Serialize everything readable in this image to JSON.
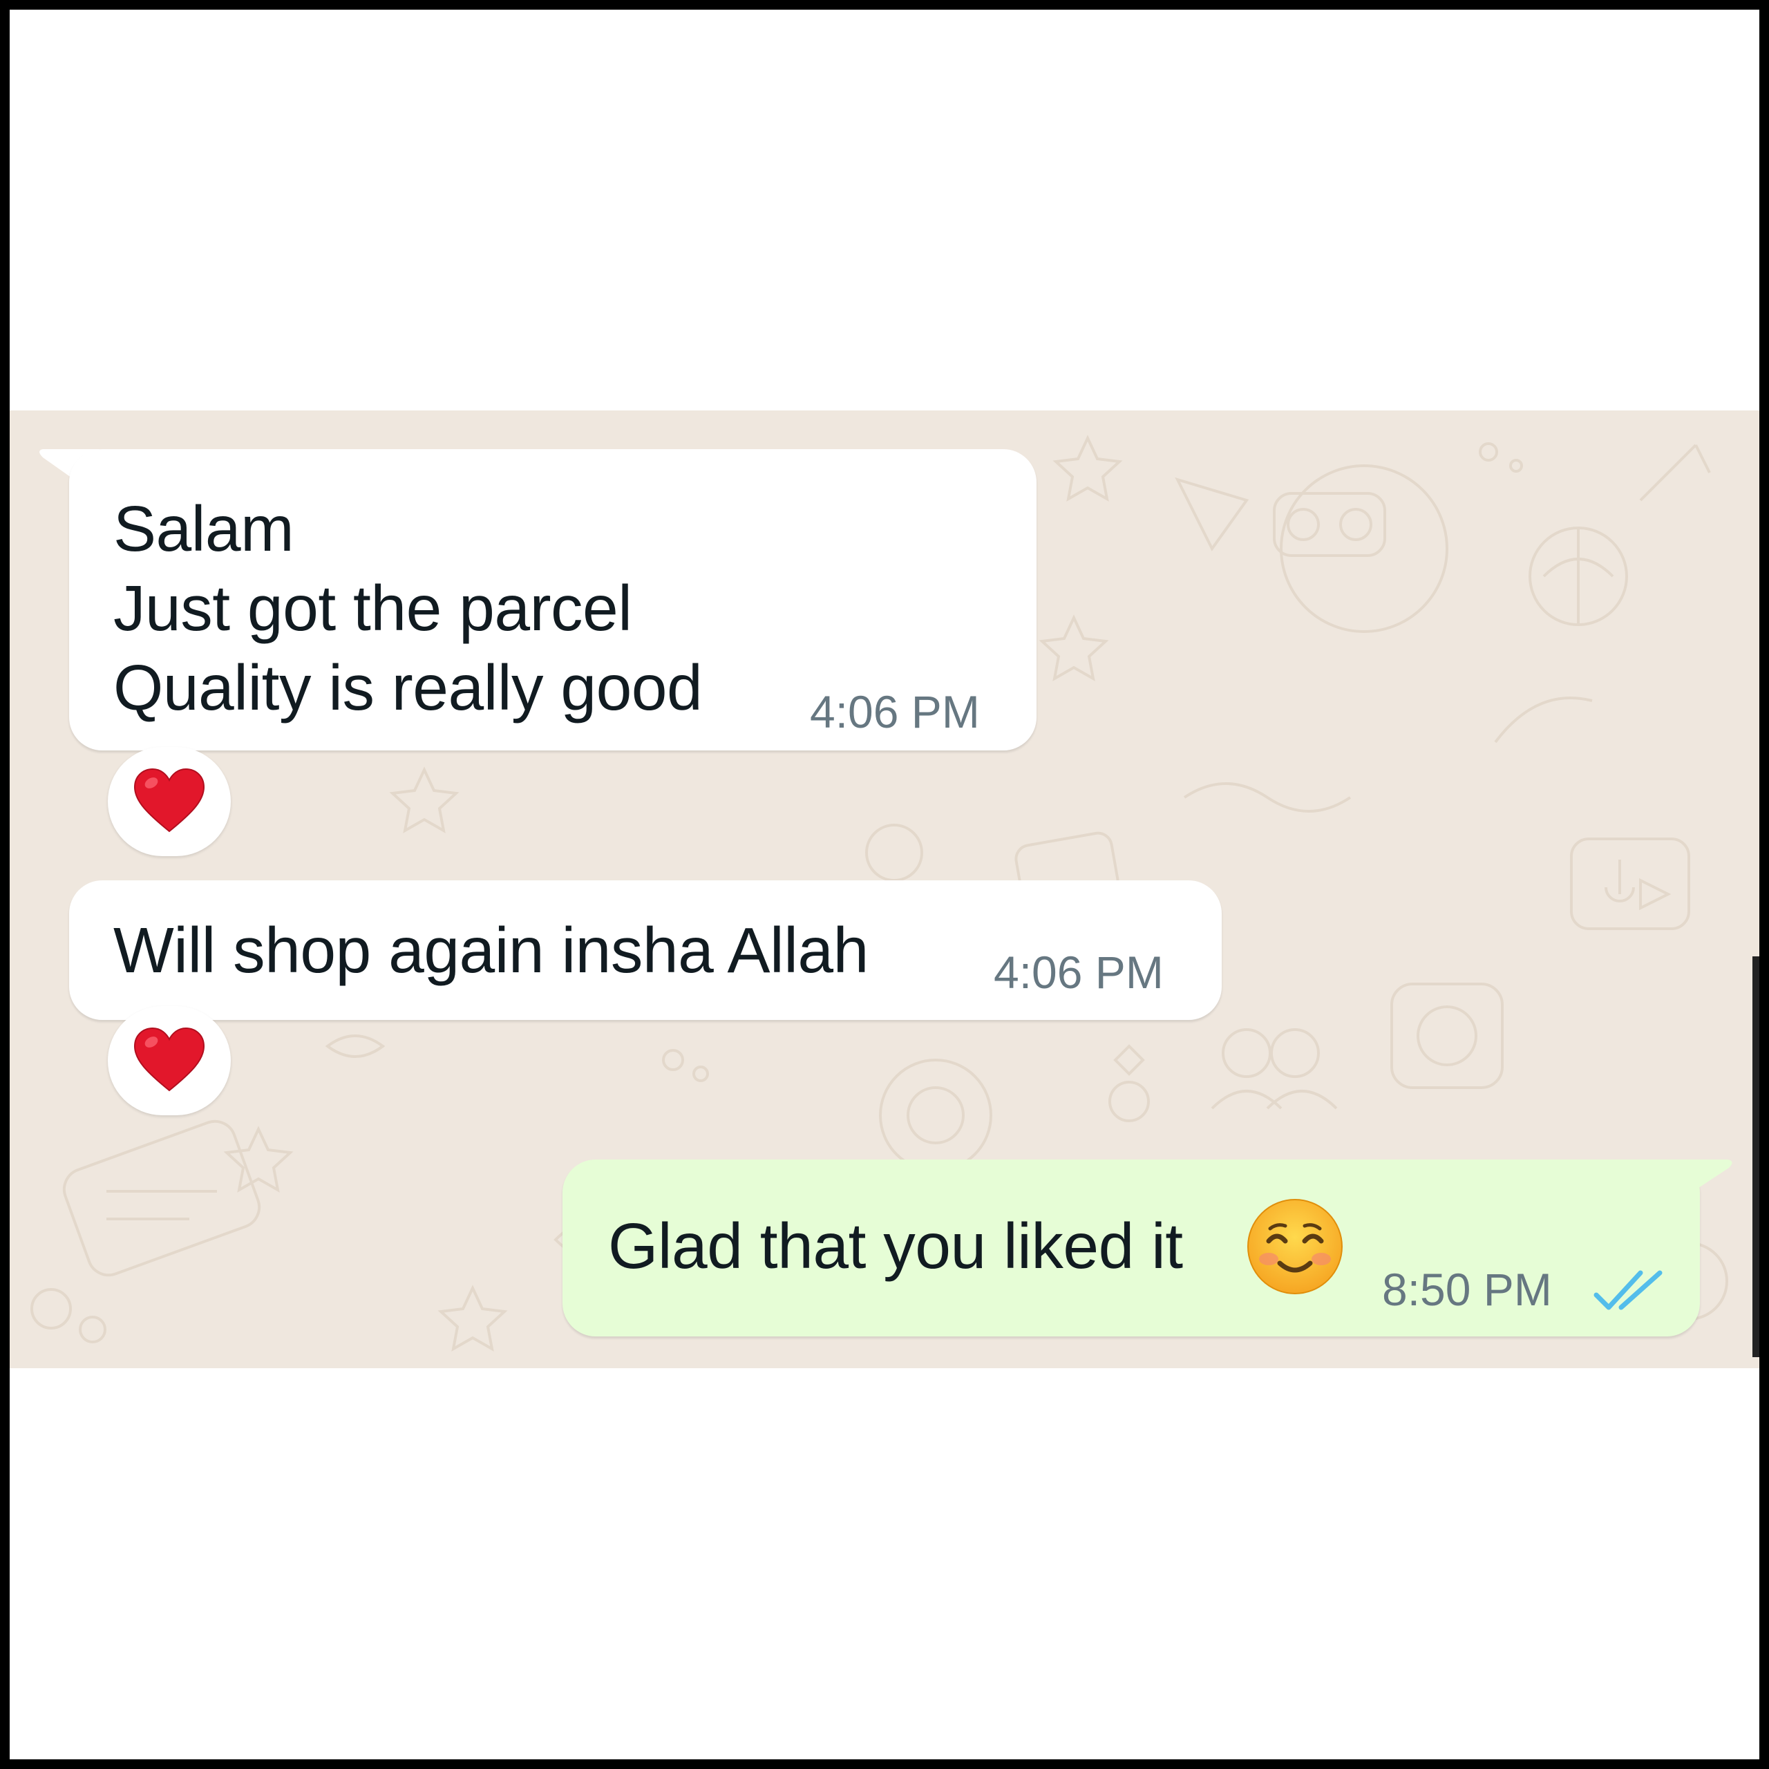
{
  "conversation": {
    "messages": [
      {
        "direction": "incoming",
        "lines": [
          "Salam",
          "Just got the parcel",
          "Quality is really good"
        ],
        "time": "4:06 PM",
        "reaction_icon": "red-heart-icon"
      },
      {
        "direction": "incoming",
        "text": "Will shop again insha Allah",
        "time": "4:06 PM",
        "reaction_icon": "red-heart-icon"
      },
      {
        "direction": "outgoing",
        "text": "Glad that you liked it",
        "emoji_icon": "smiling-face-with-smiling-eyes-icon",
        "time": "8:50 PM",
        "status_icon": "double-check-read-icon"
      }
    ]
  },
  "colors": {
    "chat_background": "#efe7de",
    "incoming_bubble": "#ffffff",
    "outgoing_bubble": "#e6fdd6",
    "read_ticks": "#53bdeb",
    "timestamp": "#667781",
    "message_text": "#111b21"
  }
}
